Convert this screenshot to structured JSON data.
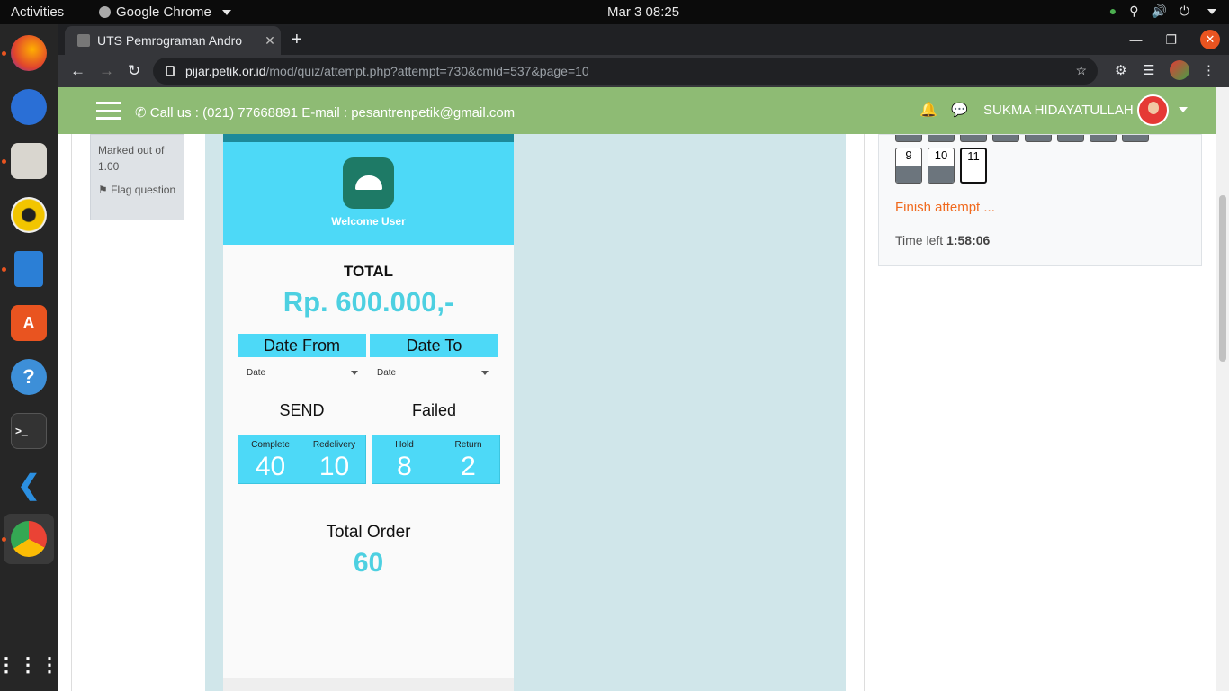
{
  "os": {
    "activities": "Activities",
    "app_name": "Google Chrome",
    "clock": "Mar 3  08:25"
  },
  "browser": {
    "tab_title": "UTS Pemrograman Andro",
    "url_host": "pijar.petik.or.id",
    "url_path": "/mod/quiz/attempt.php?attempt=730&cmid=537&page=10"
  },
  "header": {
    "contact": "Call us : (021) 77668891  E-mail : pesantrenpetik@gmail.com",
    "username": "SUKMA HIDAYATULLAH"
  },
  "question_info": {
    "marked": "Marked out of 1.00",
    "flag": "Flag question"
  },
  "app_screen": {
    "welcome": "Welcome User",
    "total_label": "TOTAL",
    "total_value": "Rp. 600.000,-",
    "date_from": "Date From",
    "date_to": "Date To",
    "date_from_select": "Date",
    "date_to_select": "Date",
    "send_title": "SEND",
    "failed_title": "Failed",
    "send_stats": [
      {
        "label": "Complete",
        "value": "40"
      },
      {
        "label": "Redelivery",
        "value": "10"
      }
    ],
    "failed_stats": [
      {
        "label": "Hold",
        "value": "8"
      },
      {
        "label": "Return",
        "value": "2"
      }
    ],
    "order_label": "Total Order",
    "order_value": "60"
  },
  "quiz_nav": {
    "buttons": [
      {
        "label": "9",
        "answered": true
      },
      {
        "label": "10",
        "answered": true
      },
      {
        "label": "11",
        "answered": false,
        "current": true
      }
    ],
    "finish": "Finish attempt ...",
    "time_label": "Time left ",
    "time_value": "1:58:06"
  }
}
